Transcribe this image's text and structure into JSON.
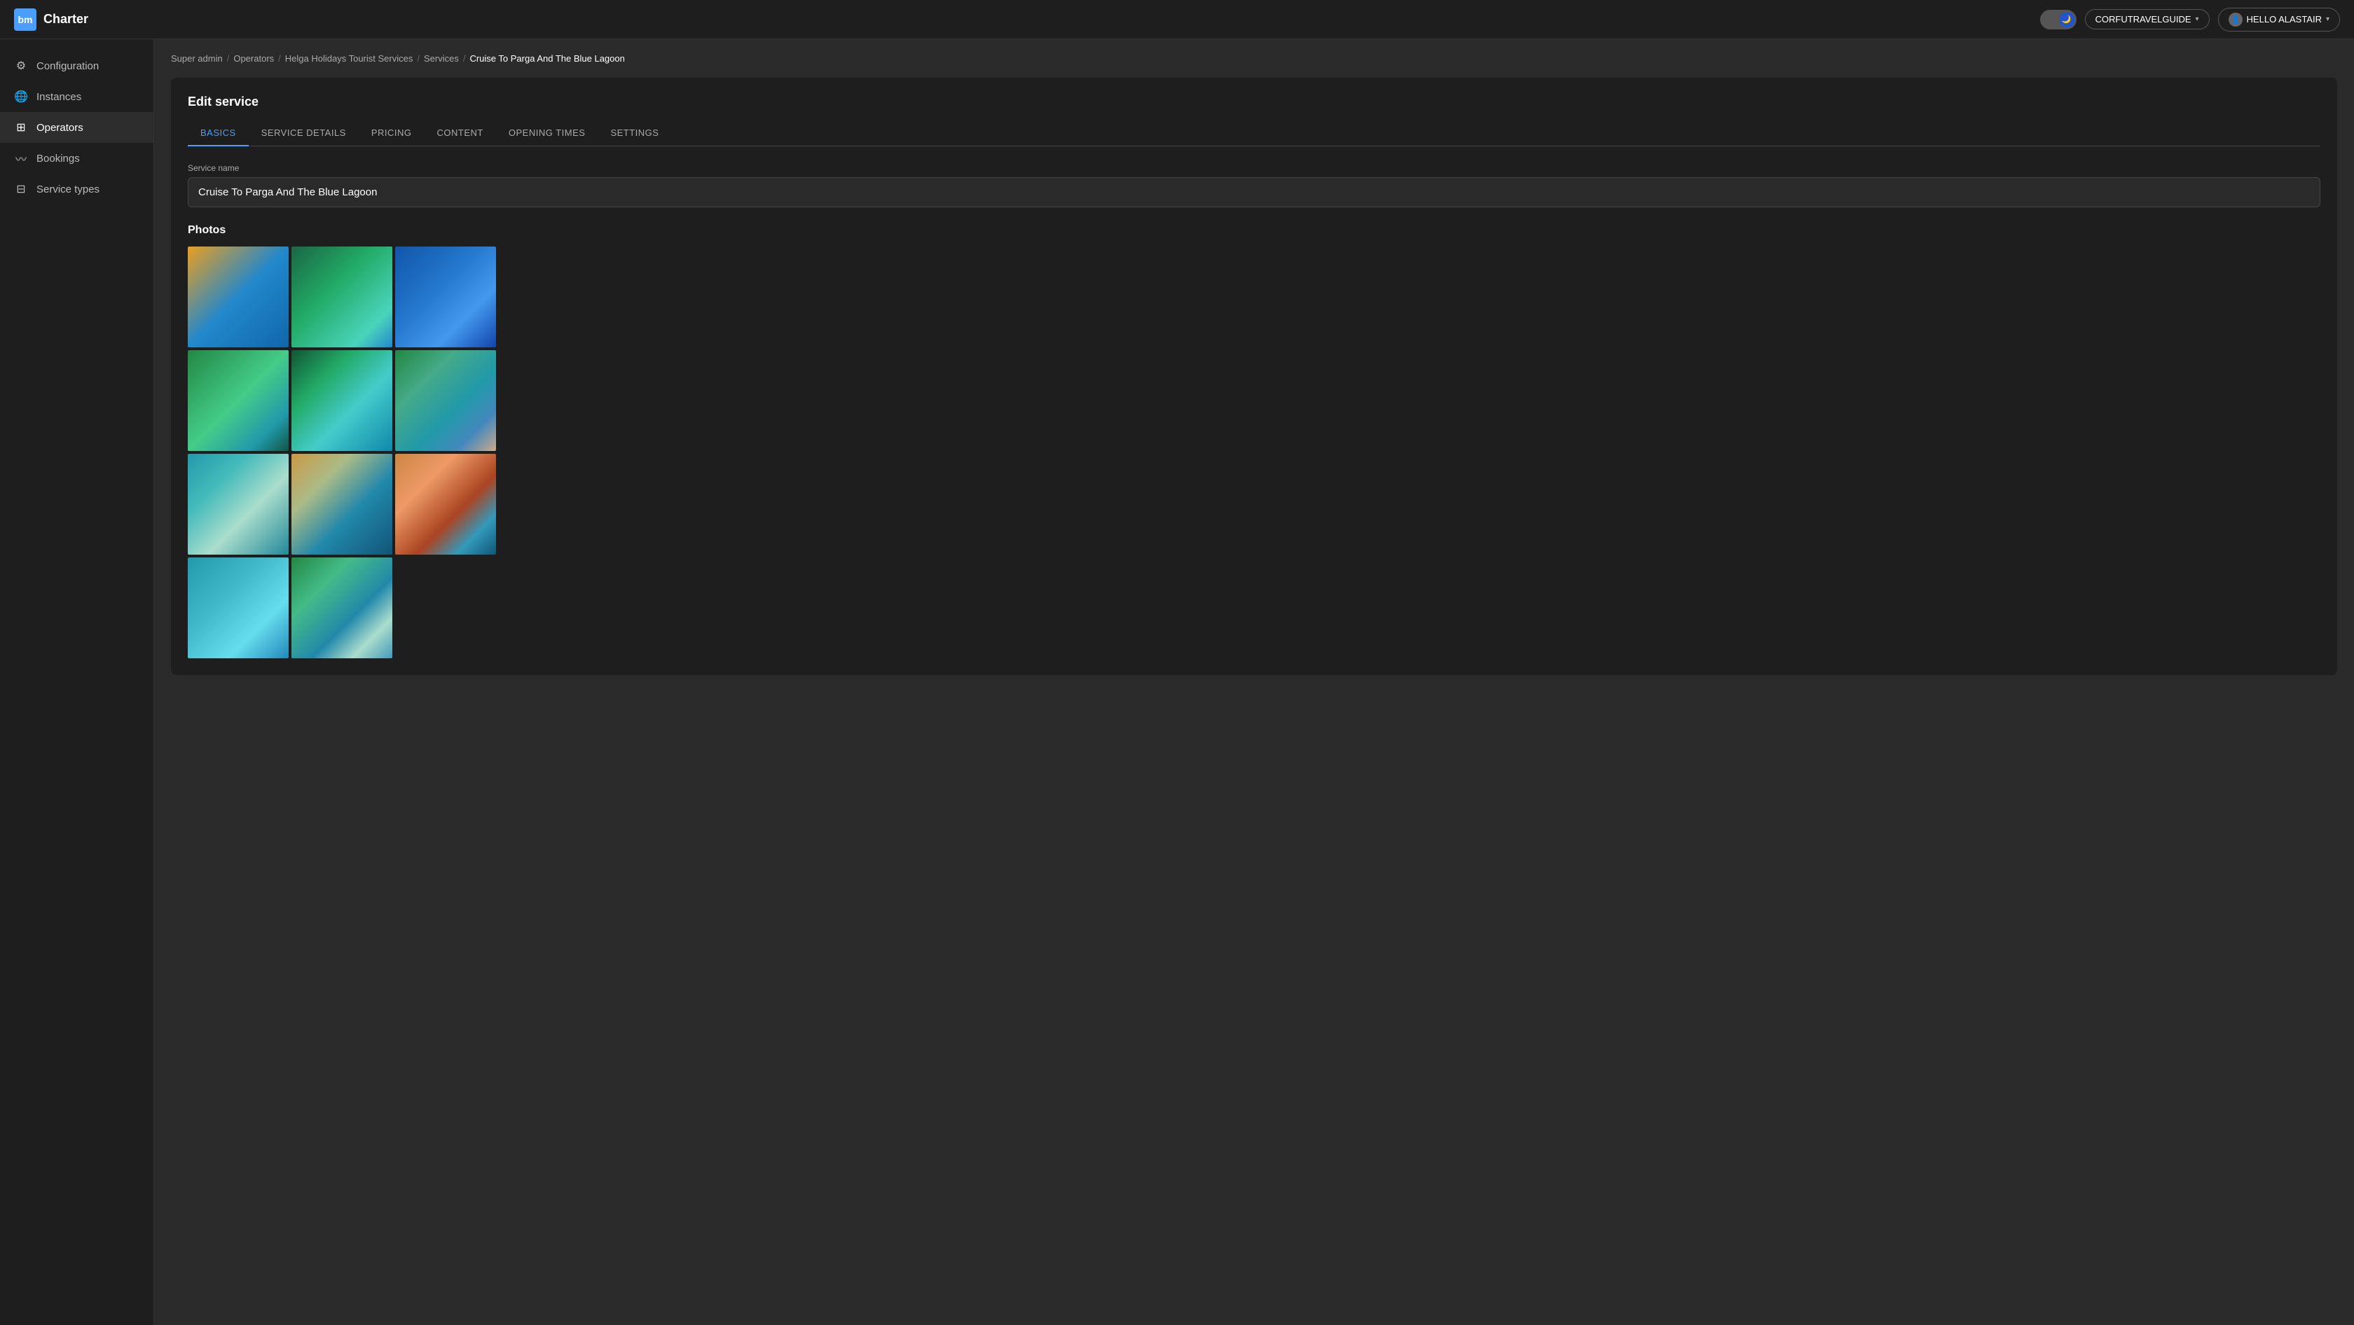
{
  "app": {
    "title": "Charter",
    "logo_text": "bm"
  },
  "topbar": {
    "instance_label": "CORFUTRAVELGUIDE",
    "user_label": "HELLO ALASTAIR",
    "chevron": "▾"
  },
  "sidebar": {
    "items": [
      {
        "id": "configuration",
        "label": "Configuration",
        "icon": "⚙"
      },
      {
        "id": "instances",
        "label": "Instances",
        "icon": "🌐"
      },
      {
        "id": "operators",
        "label": "Operators",
        "icon": "⊞"
      },
      {
        "id": "bookings",
        "label": "Bookings",
        "icon": "∿"
      },
      {
        "id": "service-types",
        "label": "Service types",
        "icon": "⊟"
      }
    ],
    "active": "operators"
  },
  "breadcrumb": {
    "items": [
      {
        "label": "Super admin",
        "link": true
      },
      {
        "label": "Operators",
        "link": true
      },
      {
        "label": "Helga Holidays Tourist Services",
        "link": true
      },
      {
        "label": "Services",
        "link": true
      },
      {
        "label": "Cruise To Parga And The Blue Lagoon",
        "link": false
      }
    ]
  },
  "edit_service": {
    "title": "Edit service",
    "tabs": [
      {
        "id": "basics",
        "label": "BASICS",
        "active": true
      },
      {
        "id": "service-details",
        "label": "SERVICE DETAILS",
        "active": false
      },
      {
        "id": "pricing",
        "label": "PRICING",
        "active": false
      },
      {
        "id": "content",
        "label": "CONTENT",
        "active": false
      },
      {
        "id": "opening-times",
        "label": "OPENING TIMES",
        "active": false
      },
      {
        "id": "settings",
        "label": "SETTINGS",
        "active": false
      }
    ],
    "service_name_label": "Service name",
    "service_name_value": "Cruise To Parga And The Blue Lagoon",
    "photos_label": "Photos",
    "photos": [
      {
        "id": "photo-1",
        "alt": "Colorful harbor town"
      },
      {
        "id": "photo-2",
        "alt": "Aerial green cove"
      },
      {
        "id": "photo-3",
        "alt": "Boat on blue sea"
      },
      {
        "id": "photo-4",
        "alt": "Green coastal lagoon"
      },
      {
        "id": "photo-5",
        "alt": "Aerial cliff cove"
      },
      {
        "id": "photo-6",
        "alt": "Coastal castle hillside"
      },
      {
        "id": "photo-7",
        "alt": "Beach with umbrellas"
      },
      {
        "id": "photo-8",
        "alt": "Coastal town aerial"
      },
      {
        "id": "photo-9",
        "alt": "Seaside town rooftops"
      },
      {
        "id": "photo-10",
        "alt": "Clear blue lagoon"
      },
      {
        "id": "photo-11",
        "alt": "Coastal landscape"
      }
    ]
  }
}
